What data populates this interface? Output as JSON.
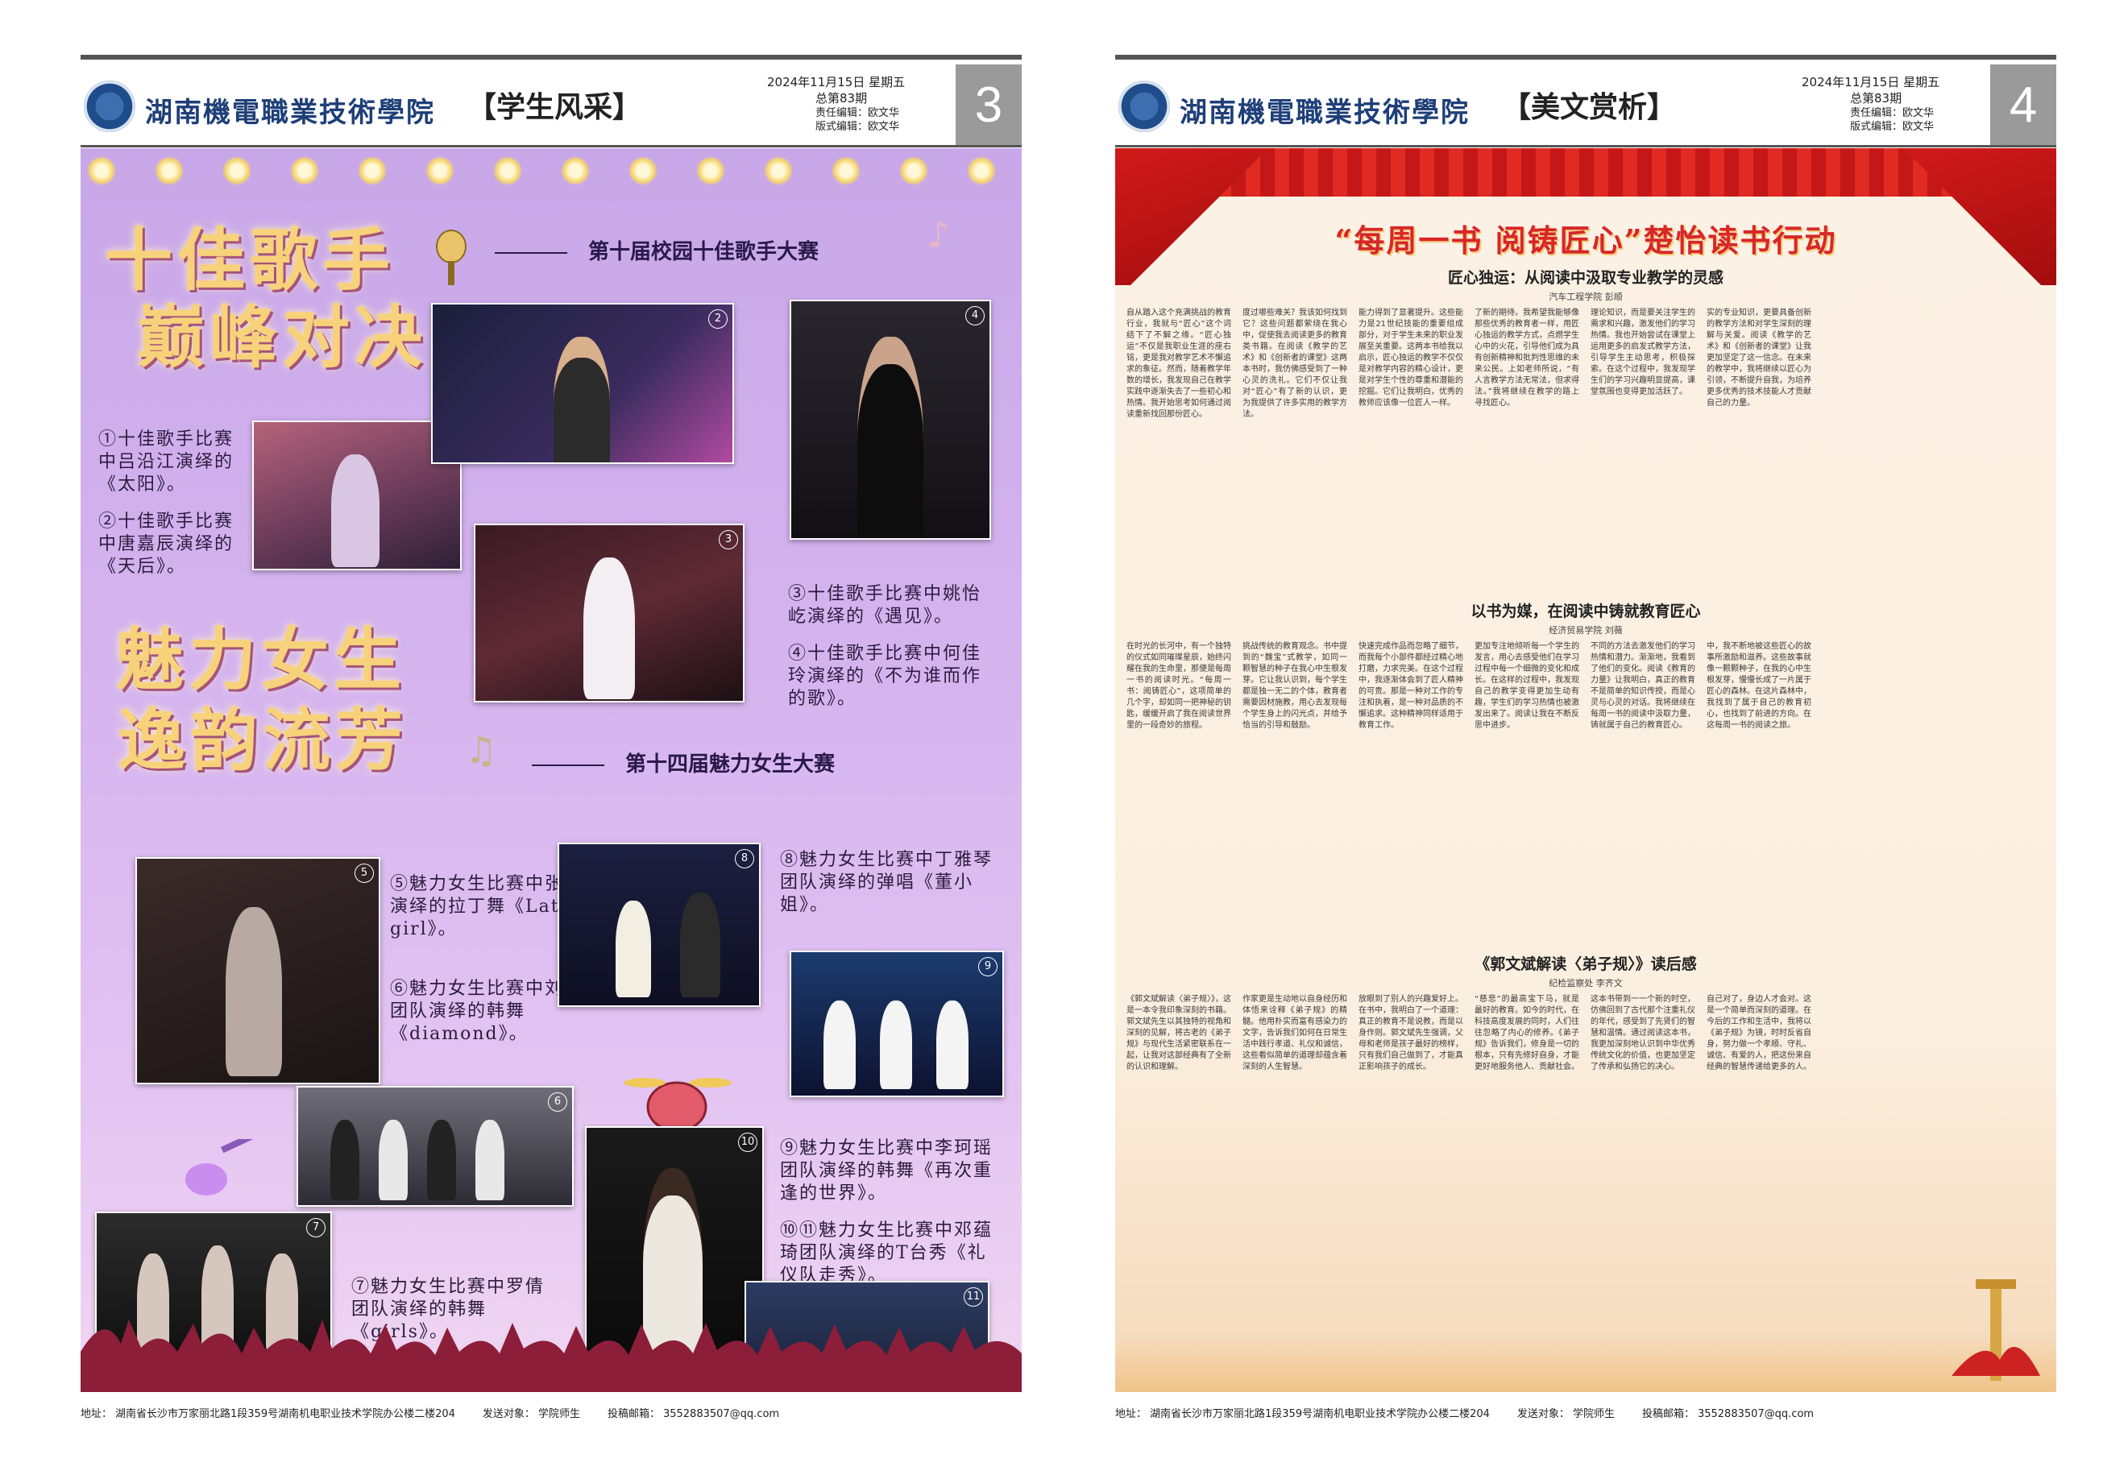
{
  "page3": {
    "school_name": "湖南機電職業技術學院",
    "section_title": "【学生风采】",
    "date": "2024年11月15日 星期五",
    "issue": "总第83期",
    "editor": "责任编辑：欧文华",
    "layout_editor": "版式编辑：欧文华",
    "page_number": "3",
    "title1_line1": "十佳歌手",
    "title1_line2": "巅峰对决",
    "subtitle1": "第十届校园十佳歌手大赛",
    "title2_line1": "魅力女生",
    "title2_line2": "逸韵流芳",
    "subtitle2": "第十四届魅力女生大赛",
    "captions": [
      "①十佳歌手比赛中吕沿江演绎的《太阳》。",
      "②十佳歌手比赛中唐嘉辰演绎的《天后》。",
      "③十佳歌手比赛中姚怡屹演绎的《遇见》。",
      "④十佳歌手比赛中何佳玲演绎的《不为谁而作的歌》。",
      "⑤魅力女生比赛中张雅婷演绎的拉丁舞《Latin girl》。",
      "⑥魅力女生比赛中刘佳莉团队演绎的韩舞《diamond》。",
      "⑦魅力女生比赛中罗倩团队演绎的韩舞《girls》。",
      "⑧魅力女生比赛中丁雅琴团队演绎的弹唱《董小姐》。",
      "⑨魅力女生比赛中李珂瑶团队演绎的韩舞《再次重逢的世界》。",
      "⑩⑪魅力女生比赛中邓蕴琦团队演绎的T台秀《礼仪队走秀》。"
    ],
    "photo_numbers": [
      "1",
      "2",
      "3",
      "4",
      "5",
      "6",
      "7",
      "8",
      "9",
      "10",
      "11"
    ]
  },
  "page4": {
    "school_name": "湖南機電職業技術學院",
    "section_title": "【美文赏析】",
    "date": "2024年11月15日 星期五",
    "issue": "总第83期",
    "editor": "责任编辑：欧文华",
    "layout_editor": "版式编辑：欧文华",
    "page_number": "4",
    "main_title": "“每周一书 阅铸匠心”楚怡读书行动",
    "articles": [
      {
        "headline": "匠心独运：从阅读中汲取专业教学的灵感",
        "byline": "汽车工程学院 彭顺",
        "columns": [
          "自从踏入这个充满挑战的教育行业，我就与“匠心”这个词结下了不解之缘。“匠心独运”不仅是我职业生涯的座右铭，更是我对教学艺术不懈追求的象征。然而，随着教学年数的增长，我发现自己在教学实践中逐渐失去了一些初心和热情。我开始思考如何通过阅读重新找回那份匠心。",
          "度过哪些难关？我该如何找到它？这些问题都萦绕在我心中，促使我去阅读更多的教育类书籍。在阅读《教学的艺术》和《创新者的课堂》这两本书时，我仿佛感受到了一种心灵的洗礼。它们不仅让我对“匠心”有了新的认识，更为我提供了许多实用的教学方法。",
          "能力得到了显著提升。这些能力是21世纪技能的重要组成部分，对于学生未来的职业发展至关重要。这两本书给我以启示，匠心独运的教学不仅仅是对教学内容的精心设计，更是对学生个性的尊重和潜能的挖掘。它们让我明白，优秀的教师应该像一位匠人一样。",
          "了新的期待。我希望我能够像那些优秀的教育者一样，用匠心独运的教学方式，点燃学生心中的火花，引导他们成为具有创新精神和批判性思维的未来公民。上如老师所说，“有人言教学方法无常法，但求得法。”我将继续在教学的路上寻找匠心。",
          "理论知识，而是要关注学生的需求和兴趣，激发他们的学习热情。我也开始尝试在课堂上运用更多的启发式教学方法，引导学生主动思考，积极探索。在这个过程中，我发现学生们的学习兴趣明显提高，课堂氛围也变得更加活跃了。",
          "实的专业知识，更要具备创新的教学方法和对学生深刻的理解与关爱。阅读《教学的艺术》和《创新者的课堂》让我更加坚定了这一信念。在未来的教学中，我将继续以匠心为引领，不断提升自我，为培养更多优秀的技术技能人才贡献自己的力量。"
        ]
      },
      {
        "headline": "以书为媒，在阅读中铸就教育匠心",
        "byline": "经济贸易学院 刘薇",
        "columns": [
          "在时光的长河中，有一个独特的仪式如同璀璨星辰，始终闪耀在我的生命里，那便是每周一书的阅读时光。“每周一书：阅铸匠心”，这项简单的几个字，却如同一把神秘的钥匙，缓缓开启了我在阅读世界里的一段奇妙的旅程。",
          "挑战传统的教育观念。书中提到的“魏宝”式教学，如同一颗智慧的种子在我心中生根发芽。它让我认识到，每个学生都是独一无二的个体，教育者需要因材施教，用心去发现每个学生身上的闪光点，并给予恰当的引导和鼓励。",
          "快速完成作品而忽略了细节，而我每个小部件都经过精心地打磨，力求完美。在这个过程中，我逐渐体会到了匠人精神的可贵。那是一种对工作的专注和执着，是一种对品质的不懈追求。这种精神同样适用于教育工作。",
          "更加专注地倾听每一个学生的发言，用心去感受他们在学习过程中每一个细微的变化和成长。在这样的过程中，我发现自己的教学变得更加生动有趣，学生们的学习热情也被激发出来了。阅读让我在不断反思中进步。",
          "不同的方法去激发他们的学习热情和潜力。渐渐地，我看到了他们的变化。阅读《教育的力量》让我明白，真正的教育不是简单的知识传授，而是心灵与心灵的对话。我将继续在每周一书的阅读中汲取力量，铸就属于自己的教育匠心。",
          "中，我不断地被这些匠心的故事所激励和滋养。这些故事就像一颗颗种子，在我的心中生根发芽，慢慢长成了一片属于匠心的森林。在这片森林中，我找到了属于自己的教育初心，也找到了前进的方向。在这每周一书的阅读之旅。"
        ]
      },
      {
        "headline": "《郭文斌解读〈弟子规〉》读后感",
        "byline": "纪检监察处 李齐文",
        "columns": [
          "《郭文斌解读〈弟子规〉》，这是一本令我印象深刻的书籍。郭文斌先生以其独特的视角和深刻的见解，将古老的《弟子规》与现代生活紧密联系在一起，让我对这部经典有了全新的认识和理解。",
          "作家更是生动地以自身经历和体悟来诠释《弟子规》的精髓。他用朴实而富有感染力的文字，告诉我们如何在日常生活中践行孝道、礼仪和诚信，这些看似简单的道理却蕴含着深刻的人生智慧。",
          "放眼到了别人的兴趣爱好上。在书中，我明白了一个道理：真正的教育不是说教，而是以身作则。郭文斌先生强调，父母和老师是孩子最好的榜样，只有我们自己做到了，才能真正影响孩子的成长。",
          "“慈悲”的最高宝下马，就是最好的教育。如今的时代，在科技高度发展的同时，人们往往忽略了内心的修养。《弟子规》告诉我们，修身是一切的根本，只有先修好自身，才能更好地服务他人、贡献社会。",
          "这本书带到一一个新的时空，仿佛回到了古代那个注重礼仪的年代，感受到了先贤们的智慧和温情。通过阅读这本书，我更加深刻地认识到中华优秀传统文化的价值，也更加坚定了传承和弘扬它的决心。",
          "自己对了，身边人才会对。这是一个简单而深刻的道理。在今后的工作和生活中，我将以《弟子规》为镜，时时反省自身，努力做一个孝顺、守礼、诚信、有爱的人，把这份来自经典的智慧传递给更多的人。"
        ]
      }
    ]
  },
  "footer": {
    "address_label": "地址：",
    "address": "湖南省长沙市万家丽北路1段359号湖南机电职业技术学院办公楼二楼204",
    "target_label": "发送对象：",
    "target": "学院师生",
    "email_label": "投稿邮箱：",
    "email": "3552883507@qq.com"
  },
  "colors": {
    "brand_blue": "#1e3f78",
    "title_red": "#d7262a",
    "gold": "#f7d27a",
    "purple_bg": "#c8a7e8"
  }
}
